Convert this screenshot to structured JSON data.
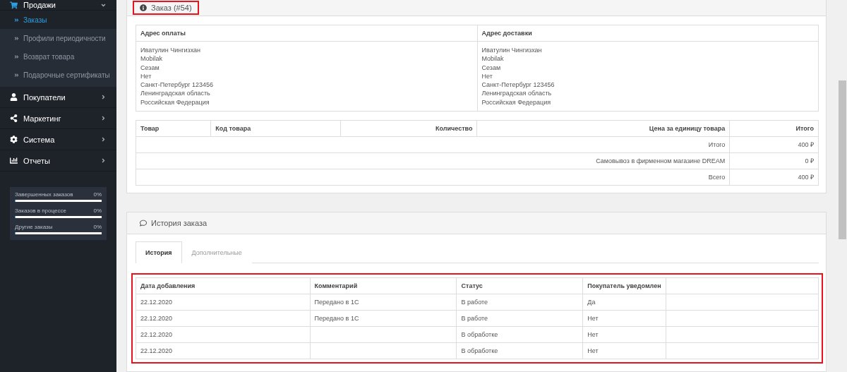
{
  "sidebar": {
    "menu": [
      {
        "label": "Продажи",
        "expanded": true,
        "children": [
          {
            "label": "Заказы",
            "selected": true
          },
          {
            "label": "Профили периодичности",
            "selected": false
          },
          {
            "label": "Возврат товара",
            "selected": false
          },
          {
            "label": "Подарочные сертификаты",
            "selected": false
          }
        ]
      },
      {
        "label": "Покупатели",
        "expanded": false
      },
      {
        "label": "Маркетинг",
        "expanded": false
      },
      {
        "label": "Система",
        "expanded": false
      },
      {
        "label": "Отчеты",
        "expanded": false
      }
    ],
    "stats": [
      {
        "label": "Завершенных заказов",
        "value": "0%",
        "level": 0
      },
      {
        "label": "Заказов в процессе",
        "value": "0%",
        "level": 0
      },
      {
        "label": "Другие заказы",
        "value": "0%",
        "level": 0
      }
    ]
  },
  "order_panel": {
    "title": "Заказ (#54)",
    "highlighted": true,
    "addresses": [
      {
        "heading": "Адрес оплаты",
        "lines": [
          "Иватулин Чингизхан",
          "Mobilak",
          "Сезам",
          "Нет",
          "Санкт-Петербург 123456",
          "Ленинградская область",
          "Российская Федерация"
        ]
      },
      {
        "heading": "Адрес доставки",
        "lines": [
          "Иватулин Чингизхан",
          "Mobilak",
          "Сезам",
          "Нет",
          "Санкт-Петербург 123456",
          "Ленинградская область",
          "Российская Федерация"
        ]
      }
    ],
    "products": {
      "columns": [
        "Товар",
        "Код товара",
        "Количество",
        "Цена за единицу товара",
        "Итого"
      ],
      "totals": [
        {
          "label": "Итого",
          "value": "400 ₽"
        },
        {
          "label": "Самовывоз в фирменном магазине DREAM",
          "value": "0 ₽"
        },
        {
          "label": "Всего",
          "value": "400 ₽"
        }
      ]
    }
  },
  "history_panel": {
    "title": "История заказа",
    "tabs": [
      {
        "label": "История",
        "selected": true
      },
      {
        "label": "Дополнительные",
        "selected": false
      }
    ],
    "table": {
      "highlighted": true,
      "columns": [
        "Дата добавления",
        "Комментарий",
        "Статус",
        "Покупатель уведомлен"
      ],
      "rows": [
        [
          "22.12.2020",
          "Передано в 1С",
          "В работе",
          "Да"
        ],
        [
          "22.12.2020",
          "Передано в 1С",
          "В работе",
          "Нет"
        ],
        [
          "22.12.2020",
          "",
          "В обработке",
          "Нет"
        ],
        [
          "22.12.2020",
          "",
          "В обработке",
          "Нет"
        ]
      ]
    }
  }
}
